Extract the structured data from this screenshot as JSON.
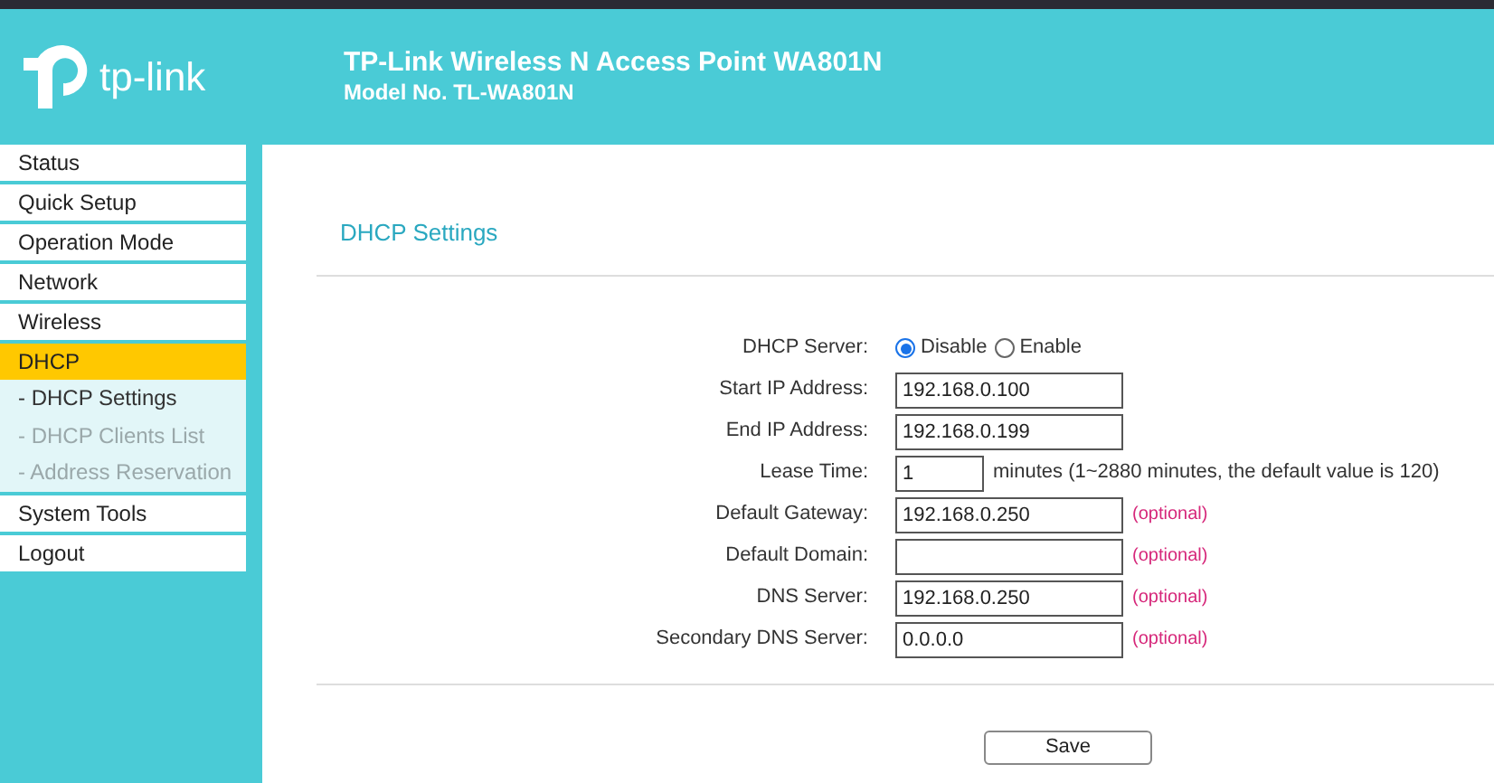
{
  "header": {
    "logo_text": "tp-link",
    "title": "TP-Link Wireless N Access Point WA801N",
    "model": "Model No. TL-WA801N"
  },
  "menu": [
    {
      "label": "Status",
      "selected": false
    },
    {
      "label": "Quick Setup",
      "selected": false
    },
    {
      "label": "Operation Mode",
      "selected": false
    },
    {
      "label": "Network",
      "selected": false
    },
    {
      "label": "Wireless",
      "selected": false
    },
    {
      "label": "DHCP",
      "selected": true,
      "children": [
        {
          "label": "- DHCP Settings",
          "selected": true
        },
        {
          "label": "- DHCP Clients List",
          "selected": false
        },
        {
          "label": "- Address Reservation",
          "selected": false
        }
      ]
    },
    {
      "label": "System Tools",
      "selected": false
    },
    {
      "label": "Logout",
      "selected": false
    }
  ],
  "page_title": "DHCP Settings",
  "fields": [
    {
      "kind": "radio",
      "label": "DHCP Server:",
      "options": [
        {
          "label": "Disable",
          "selected": true
        },
        {
          "label": "Enable",
          "selected": false
        }
      ]
    },
    {
      "kind": "text",
      "label": "Start IP Address:",
      "value": "192.168.0.100"
    },
    {
      "kind": "text",
      "label": "End IP Address:",
      "value": "192.168.0.199"
    },
    {
      "kind": "short",
      "label": "Lease Time:",
      "value": "1",
      "note": "minutes (1~2880 minutes, the default value is 120)"
    },
    {
      "kind": "text",
      "label": "Default Gateway:",
      "value": "192.168.0.250",
      "hint": "(optional)"
    },
    {
      "kind": "text",
      "label": "Default Domain:",
      "hint": "(optional)"
    },
    {
      "kind": "text",
      "label": "DNS Server:",
      "value": "192.168.0.250",
      "hint": "(optional)"
    },
    {
      "kind": "text",
      "label": "Secondary DNS Server:",
      "value": "0.0.0.0",
      "hint": "(optional)"
    }
  ],
  "save_button": "Save"
}
